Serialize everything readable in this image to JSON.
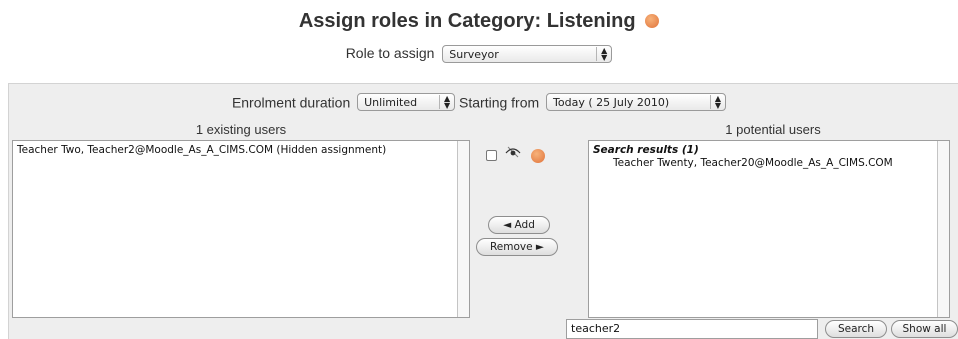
{
  "heading": {
    "title": "Assign roles in Category: Listening"
  },
  "role": {
    "label": "Role to assign",
    "selected": "Surveyor"
  },
  "enrolment": {
    "duration_label": "Enrolment duration",
    "duration_value": "Unlimited",
    "start_label": "Starting from",
    "start_value": "Today ( 25 July 2010)"
  },
  "existing": {
    "label": "1 existing users",
    "items": [
      "Teacher Two, Teacher2@Moodle_As_A_CIMS.COM (Hidden assignment)"
    ]
  },
  "potential": {
    "label": "1 potential users",
    "group": "Search results (1)",
    "items": [
      "Teacher Twenty, Teacher20@Moodle_As_A_CIMS.COM"
    ]
  },
  "actions": {
    "add": "◄ Add",
    "remove": "Remove ►"
  },
  "search": {
    "value": "teacher2",
    "search_label": "Search",
    "show_all_label": "Show all"
  },
  "colors": {
    "panel_bg": "#eeeeee",
    "help_icon": "#e0733a"
  },
  "icons": [
    "help-icon",
    "eye-icon",
    "dropdown-arrows-icon"
  ]
}
